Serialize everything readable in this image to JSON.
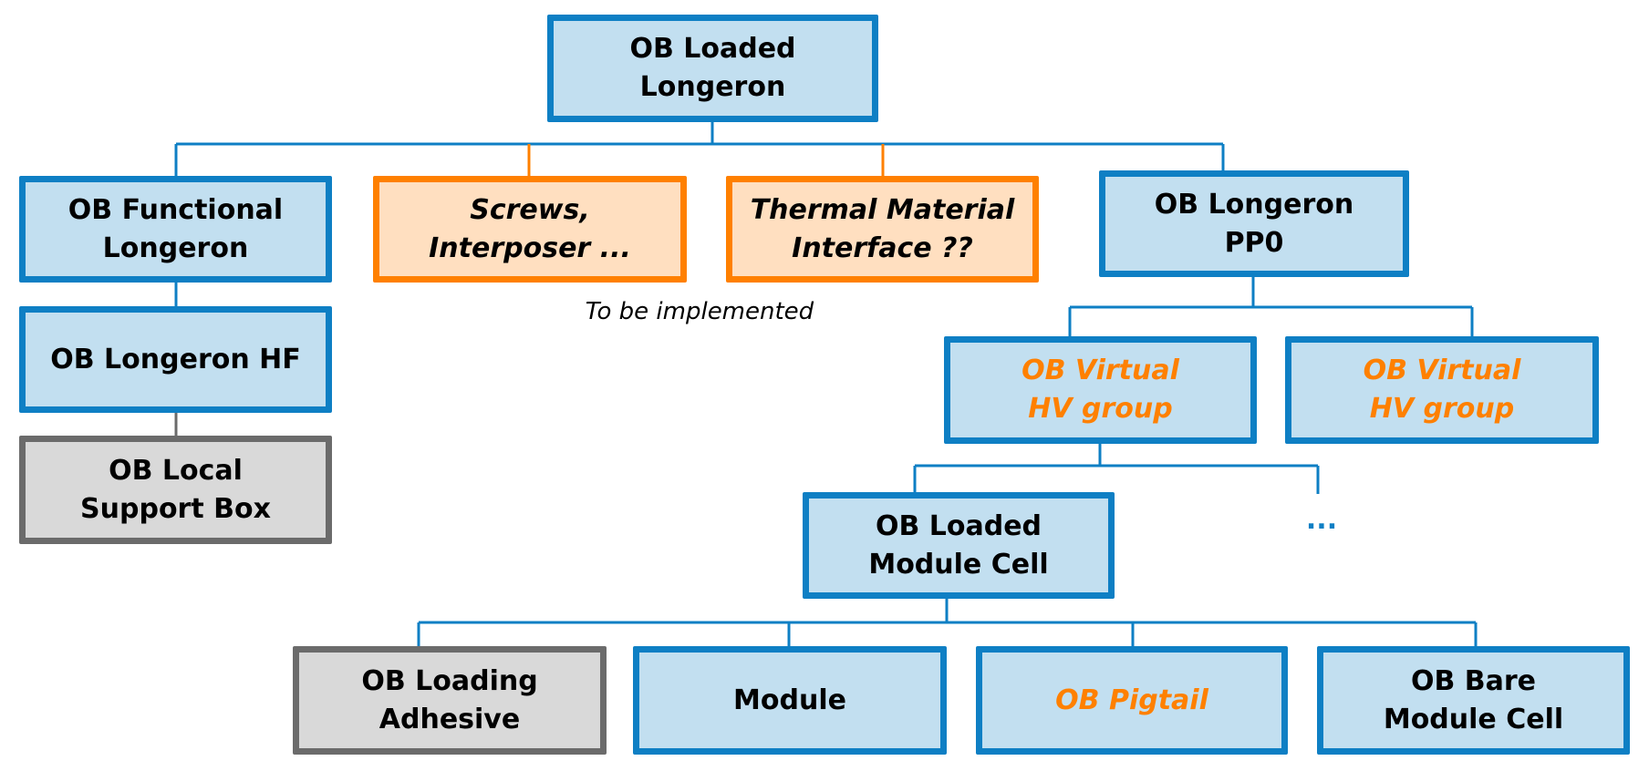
{
  "colors": {
    "blue_border": "#0e7fc4",
    "blue_fill": "#c2dff0",
    "orange": "#ff8000",
    "orange_fill": "#ffdfc0",
    "gray_border": "#6b6b6b",
    "gray_fill": "#d9d9d9"
  },
  "nodes": {
    "root": "OB Loaded\nLongeron",
    "functional": "OB Functional\nLongeron",
    "screws": "Screws,\nInterposer ...",
    "thermal": "Thermal Material\nInterface ??",
    "pp0": "OB Longeron\nPP0",
    "hf": "OB Longeron HF",
    "support_box": "OB Local\nSupport Box",
    "hv_group_1": "OB Virtual\nHV group",
    "hv_group_2": "OB Virtual\nHV group",
    "module_cell": "OB Loaded\nModule Cell",
    "adhesive": "OB Loading\nAdhesive",
    "module": "Module",
    "pigtail": "OB Pigtail",
    "bare_cell": "OB Bare\nModule Cell"
  },
  "note": "To be implemented",
  "ellipsis": "..."
}
